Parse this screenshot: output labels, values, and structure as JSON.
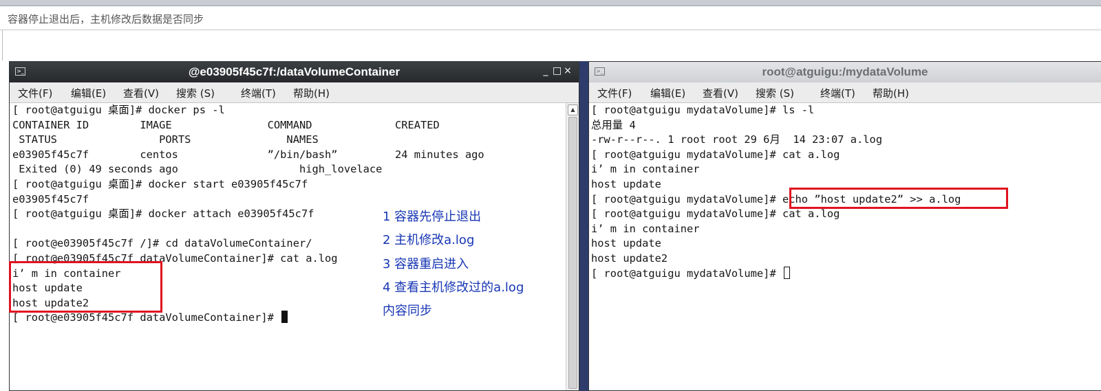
{
  "caption": "容器停止退出后，主机修改后数据是否同步",
  "colors": {
    "annotation_box": "#e0121f",
    "annotation_text": "#1736b4"
  },
  "left_window": {
    "title": "@e03905f45c7f:/dataVolumeContainer",
    "controls": [
      "_",
      "□",
      "×"
    ],
    "menu": [
      "文件(F)",
      "编辑(E)",
      "查看(V)",
      "搜索 (S)",
      "终端(T)",
      "帮助(H)"
    ],
    "lines": [
      "[ root@atguigu 桌面]# docker ps -l",
      "CONTAINER ID        IMAGE               COMMAND             CREATED",
      " STATUS                PORTS               NAMES",
      "e03905f45c7f        centos              ”/bin/bash”         24 minutes ago",
      " Exited (0) 49 seconds ago                   high_lovelace",
      "[ root@atguigu 桌面]# docker start e03905f45c7f",
      "e03905f45c7f",
      "[ root@atguigu 桌面]# docker attach e03905f45c7f",
      "",
      "[ root@e03905f45c7f /]# cd dataVolumeContainer/",
      "[ root@e03905f45c7f dataVolumeContainer]# cat a.log",
      "i’ m in container",
      "host update",
      "host update2"
    ],
    "prompt_line": "[ root@e03905f45c7f dataVolumeContainer]# "
  },
  "right_window": {
    "title": "root@atguigu:/mydataVolume",
    "menu": [
      "文件(F)",
      "编辑(E)",
      "查看(V)",
      "搜索 (S)",
      "终端(T)",
      "帮助(H)"
    ],
    "lines": [
      "[ root@atguigu mydataVolume]# ls -l",
      "总用量 4",
      "-rw-r--r--. 1 root root 29 6月  14 23:07 a.log",
      "[ root@atguigu mydataVolume]# cat a.log",
      "i’ m in container",
      "host update"
    ],
    "highlight_prompt": "[ root@atguigu mydataVolume]# ",
    "highlight_command": "echo ”host update2” >> a.log",
    "lines_after": [
      "[ root@atguigu mydataVolume]# cat a.log",
      "i’ m in container",
      "host update",
      "host update2"
    ],
    "prompt_line": "[ root@atguigu mydataVolume]# "
  },
  "annotations": [
    "1 容器先停止退出",
    "2 主机修改a.log",
    "3 容器重启进入",
    "4 查看主机修改过的a.log",
    "内容同步"
  ]
}
